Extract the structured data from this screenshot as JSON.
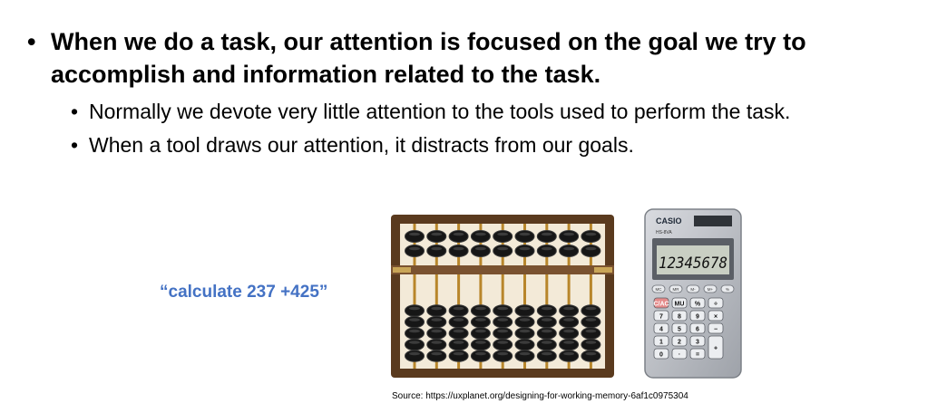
{
  "bullets": {
    "main": "When we do a task, our attention is focused on the goal we try to accomplish and information related to the task.",
    "sub": [
      "Normally we devote very little attention to the tools used to perform the task.",
      "When a tool draws our attention, it distracts from our goals."
    ]
  },
  "example_quote": "“calculate 237 +425”",
  "source": "Source: https://uxplanet.org/designing-for-working-memory-6af1c0975304",
  "calculator": {
    "brand": "CASIO",
    "model": "HS-8VA",
    "display": "12345678",
    "keys_top": [
      "MC",
      "MR",
      "M-",
      "M+",
      "%"
    ],
    "keys": [
      "C/AC",
      "MU",
      "%",
      "÷",
      "7",
      "8",
      "9",
      "×",
      "4",
      "5",
      "6",
      "−",
      "1",
      "2",
      "3",
      "+",
      "0",
      "·",
      "="
    ]
  },
  "icons": {
    "abacus": "abacus-image",
    "calculator": "calculator-image"
  }
}
